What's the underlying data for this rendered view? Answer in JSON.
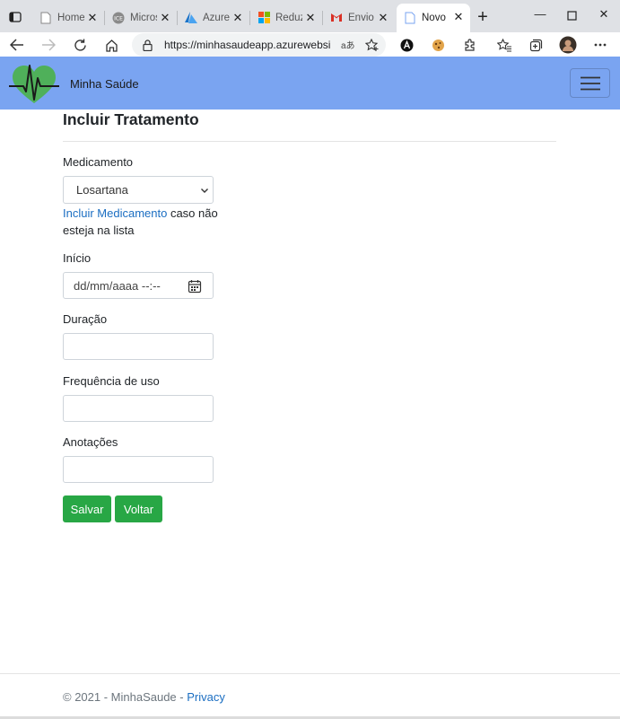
{
  "browser": {
    "tabs": [
      {
        "title": "Home",
        "icon": "page-icon"
      },
      {
        "title": "Microsoft",
        "icon": "ice-icon"
      },
      {
        "title": "Azure",
        "icon": "azure-icon"
      },
      {
        "title": "Reduzir",
        "icon": "windows-icon"
      },
      {
        "title": "Envio",
        "icon": "gmail-icon"
      },
      {
        "title": "Novo T",
        "icon": "page-icon",
        "active": true
      }
    ],
    "address": {
      "url": "https://minhasaudeapp.azurewebsit...",
      "read_aloud": "aあ"
    }
  },
  "navbar": {
    "brand": "Minha Saúde",
    "accent_color": "#7aa4f1"
  },
  "form": {
    "title": "Incluir Tratamento",
    "medicamento_label": "Medicamento",
    "medicamento_value": "Losartana",
    "include_link": "Incluir Medicamento",
    "include_hint_rest": " caso não esteja na lista",
    "inicio_label": "Início",
    "inicio_placeholder": "dd/mm/aaaa --:--",
    "duracao_label": "Duração",
    "duracao_value": "",
    "frequencia_label": "Frequência de uso",
    "frequencia_value": "",
    "anotacoes_label": "Anotações",
    "anotacoes_value": "",
    "save_label": "Salvar",
    "back_label": "Voltar",
    "button_color": "#28a745"
  },
  "footer": {
    "copyright": "© 2021 - MinhaSaude - ",
    "privacy_link": "Privacy"
  }
}
